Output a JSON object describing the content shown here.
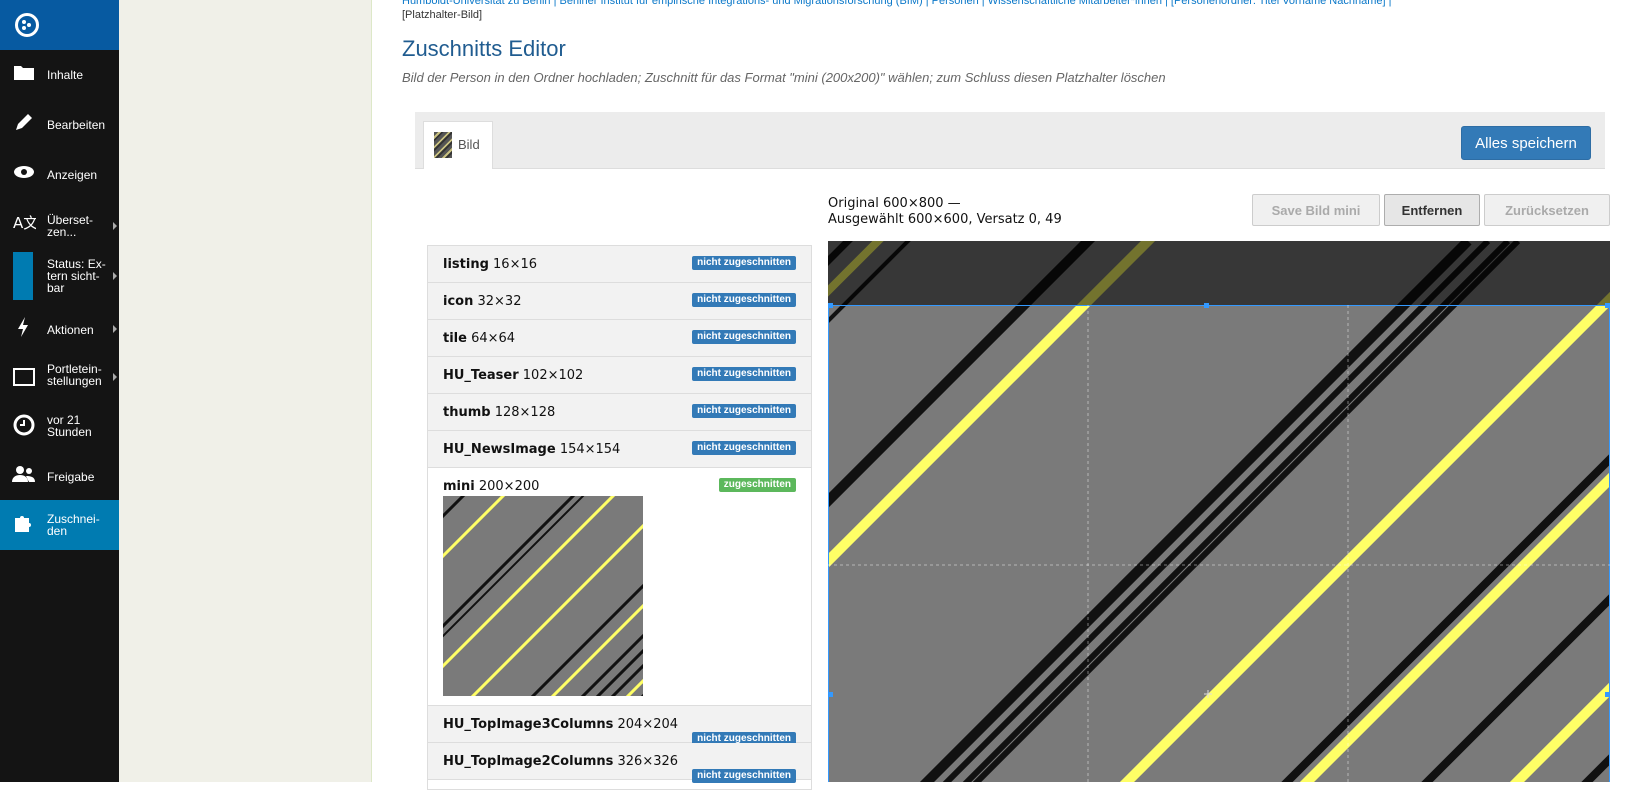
{
  "toolbar": {
    "items": [
      {
        "label": "Inhalte",
        "icon": "folder-icon"
      },
      {
        "label": "Bearbeiten",
        "icon": "pencil-icon"
      },
      {
        "label": "Anzeigen",
        "icon": "eye-icon"
      },
      {
        "label": "Überset-\nzen...",
        "icon": "translate-icon"
      },
      {
        "label": "Status: Ex-\ntern sicht-\nbar",
        "icon": "status-icon"
      },
      {
        "label": "Aktionen",
        "icon": "bolt-icon"
      },
      {
        "label": "Portletein-\nstellungen",
        "icon": "portlet-icon"
      },
      {
        "label": "vor 21\nStunden",
        "icon": "clock-icon"
      },
      {
        "label": "Freigabe",
        "icon": "users-icon"
      },
      {
        "label": "Zuschnei-\nden",
        "icon": "puzzle-icon"
      }
    ]
  },
  "breadcrumb": {
    "line1": "Humboldt-Universität zu Berlin | Berliner Institut für empirische Integrations- und Migrationsforschung (BIM) | Personen | Wissenschaftliche Mitarbeiter*innen | [Personenordner: Titel Vorname Nachname] |",
    "current": "[Platzhalter-Bild]"
  },
  "page": {
    "title": "Zuschnitts Editor",
    "description": "Bild der Person in den Ordner hochladen; Zuschnitt für das Format \"mini (200x200)\" wählen; zum Schluss diesen Platzhalter löschen"
  },
  "tabs": {
    "bild": "Bild"
  },
  "buttons": {
    "save_all": "Alles speichern",
    "save_mini": "Save Bild mini",
    "remove": "Entfernen",
    "reset": "Zurücksetzen"
  },
  "info": {
    "original": "Original 600×800 —",
    "selected": "Ausgewählt 600×600, Versatz 0, 49"
  },
  "scales": [
    {
      "name": "listing",
      "size": "16×16",
      "status": "nicht zugeschnitten"
    },
    {
      "name": "icon",
      "size": "32×32",
      "status": "nicht zugeschnitten"
    },
    {
      "name": "tile",
      "size": "64×64",
      "status": "nicht zugeschnitten"
    },
    {
      "name": "HU_Teaser",
      "size": "102×102",
      "status": "nicht zugeschnitten"
    },
    {
      "name": "thumb",
      "size": "128×128",
      "status": "nicht zugeschnitten"
    },
    {
      "name": "HU_NewsImage",
      "size": "154×154",
      "status": "nicht zugeschnitten"
    },
    {
      "name": "mini",
      "size": "200×200",
      "status": "zugeschnitten",
      "selected": true
    },
    {
      "name": "HU_TopImage3Columns",
      "size": "204×204",
      "status": "nicht zugeschnitten"
    },
    {
      "name": "HU_TopImage2Columns",
      "size": "326×326",
      "status": "nicht zugeschnitten"
    }
  ],
  "colors": {
    "toolbar_bg": "#141414",
    "toolbar_active": "#007bb1",
    "logo_bg": "#075aa1",
    "primary": "#337ab7",
    "success": "#5cb85c",
    "stripe_yellow": "#ffff66"
  }
}
